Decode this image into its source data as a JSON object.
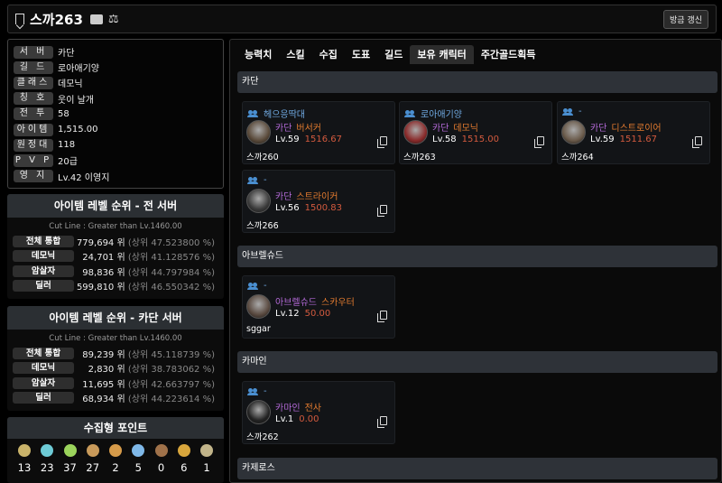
{
  "header": {
    "name": "스까263",
    "refresh_label": "방금 갱신"
  },
  "profile": [
    {
      "label": "서 버",
      "value": "카단"
    },
    {
      "label": "길 드",
      "value": "로아애기양"
    },
    {
      "label": "클래스",
      "value": "데모닉"
    },
    {
      "label": "칭 호",
      "value": "웃이 날개"
    },
    {
      "label": "전 투",
      "value": "58"
    },
    {
      "label": "아이템",
      "value": "1,515.00"
    },
    {
      "label": "원정대",
      "value": "118"
    },
    {
      "label": "P V P",
      "value": "20급"
    },
    {
      "label": "영 지",
      "value": "Lv.42 이영지"
    }
  ],
  "rank_all": {
    "title": "아이템 레벨 순위 - 전 서버",
    "cutline": "Cut Line : Greater than Lv.1460.00",
    "rows": [
      {
        "label": "전체 통합",
        "rank": "779,694 위",
        "pct": "(상위 47.523800 %)"
      },
      {
        "label": "데모닉",
        "rank": "24,701 위",
        "pct": "(상위 41.128576 %)"
      },
      {
        "label": "암살자",
        "rank": "98,836 위",
        "pct": "(상위 44.797984 %)"
      },
      {
        "label": "딜러",
        "rank": "599,810 위",
        "pct": "(상위 46.550342 %)"
      }
    ]
  },
  "rank_server": {
    "title": "아이템 레벨 순위 - 카단 서버",
    "cutline": "Cut Line : Greater than Lv.1460.00",
    "rows": [
      {
        "label": "전체 통합",
        "rank": "89,239 위",
        "pct": "(상위 45.118739 %)"
      },
      {
        "label": "데모닉",
        "rank": "2,830 위",
        "pct": "(상위 38.783062 %)"
      },
      {
        "label": "암살자",
        "rank": "11,695 위",
        "pct": "(상위 42.663797 %)"
      },
      {
        "label": "딜러",
        "rank": "68,934 위",
        "pct": "(상위 44.223614 %)"
      }
    ]
  },
  "collect": {
    "title": "수집형 포인트",
    "items": [
      {
        "icon": "mokoko-seed-icon",
        "count": "13",
        "color": "#c9b36a"
      },
      {
        "icon": "island-heart-icon",
        "count": "23",
        "color": "#6ecbd6"
      },
      {
        "icon": "giant-heart-icon",
        "count": "37",
        "color": "#9bd45c"
      },
      {
        "icon": "art-icon",
        "count": "27",
        "color": "#c89a5a"
      },
      {
        "icon": "voyage-icon",
        "count": "2",
        "color": "#d69b4a"
      },
      {
        "icon": "world-tree-leaf-icon",
        "count": "5",
        "color": "#7fb8e8"
      },
      {
        "icon": "ignea-token-icon",
        "count": "0",
        "color": "#a0724a"
      },
      {
        "icon": "orpheus-star-icon",
        "count": "6",
        "color": "#d8a63c"
      },
      {
        "icon": "sea-bounty-icon",
        "count": "1",
        "color": "#c2b58a"
      }
    ]
  },
  "tabs": [
    "능력치",
    "스킬",
    "수집",
    "도표",
    "길드",
    "보유 캐릭터",
    "주간골드획득"
  ],
  "sections": [
    {
      "name": "카단",
      "cards": [
        {
          "guild": "헤으응딱대",
          "server": "카단",
          "job": "버서커",
          "level": "Lv.59",
          "ilvl": "1516.67",
          "name": "스까260",
          "avatar": "#5a4a3a"
        },
        {
          "guild": "로아애기양",
          "server": "카단",
          "job": "데모닉",
          "level": "Lv.58",
          "ilvl": "1515.00",
          "name": "스까263",
          "avatar": "#8a2a2a"
        },
        {
          "guild": "-",
          "server": "카단",
          "job": "디스트로이어",
          "level": "Lv.59",
          "ilvl": "1511.67",
          "name": "스까264",
          "avatar": "#6a5a4a"
        },
        {
          "guild": "-",
          "server": "카단",
          "job": "스트라이커",
          "level": "Lv.56",
          "ilvl": "1500.83",
          "name": "스까266",
          "avatar": "#3a3a3a"
        }
      ]
    },
    {
      "name": "아브렐슈드",
      "cards": [
        {
          "guild": "-",
          "server": "아브렐슈드",
          "job": "스카우터",
          "level": "Lv.12",
          "ilvl": "50.00",
          "name": "sggar",
          "avatar": "#5a4a40"
        }
      ]
    },
    {
      "name": "카마인",
      "cards": [
        {
          "guild": "-",
          "server": "카마인",
          "job": "전사",
          "level": "Lv.1",
          "ilvl": "0.00",
          "name": "스까262",
          "avatar": "#222"
        }
      ]
    },
    {
      "name": "카제로스",
      "cards": []
    }
  ]
}
